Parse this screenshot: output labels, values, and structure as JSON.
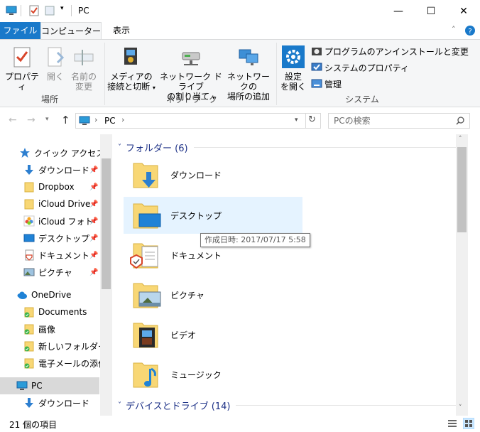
{
  "window": {
    "title": "PC",
    "minimize_glyph": "—",
    "maximize_glyph": "☐",
    "close_glyph": "✕"
  },
  "ribbon_tabs": {
    "file": "ファイル",
    "computer": "コンピューター",
    "view": "表示"
  },
  "ribbon": {
    "location": {
      "label": "場所",
      "properties": "プロパティ",
      "open_line1": "開く",
      "rename_line1": "名前の",
      "rename_line2": "変更"
    },
    "network": {
      "label": "ネットワーク",
      "media_line1": "メディアの",
      "media_line2": "接続と切断",
      "map_line1": "ネットワーク ドライブ",
      "map_line2": "の割り当て",
      "add_line1": "ネットワークの",
      "add_line2": "場所の追加"
    },
    "system": {
      "label": "システム",
      "settings_line1": "設定",
      "settings_line2": "を開く",
      "uninstall": "プログラムのアンインストールと変更",
      "sysprops": "システムのプロパティ",
      "manage": "管理"
    }
  },
  "nav": {
    "address_pc": "PC",
    "search_placeholder": "PCの検索"
  },
  "sidebar": {
    "items": [
      {
        "label": "クイック アクセス"
      },
      {
        "label": "ダウンロード"
      },
      {
        "label": "Dropbox"
      },
      {
        "label": "iCloud Drive"
      },
      {
        "label": "iCloud フォト"
      },
      {
        "label": "デスクトップ"
      },
      {
        "label": "ドキュメント"
      },
      {
        "label": "ピクチャ"
      },
      {
        "label": "OneDrive"
      },
      {
        "label": "Documents"
      },
      {
        "label": "画像"
      },
      {
        "label": "新しいフォルダー"
      },
      {
        "label": "電子メールの添付"
      },
      {
        "label": "PC"
      },
      {
        "label": "ダウンロード"
      }
    ]
  },
  "content": {
    "folders_header": "フォルダー (6)",
    "devices_header": "デバイスとドライブ (14)",
    "folders": [
      {
        "label": "ダウンロード"
      },
      {
        "label": "デスクトップ"
      },
      {
        "label": "ドキュメント"
      },
      {
        "label": "ピクチャ"
      },
      {
        "label": "ビデオ"
      },
      {
        "label": "ミュージック"
      }
    ],
    "tooltip": "作成日時: 2017/07/17 5:58"
  },
  "status": {
    "item_count": "21 個の項目"
  },
  "colors": {
    "accent": "#1979ca",
    "folder": "#f8d775",
    "header_blue": "#1e3287",
    "selection": "#e5f3ff"
  }
}
